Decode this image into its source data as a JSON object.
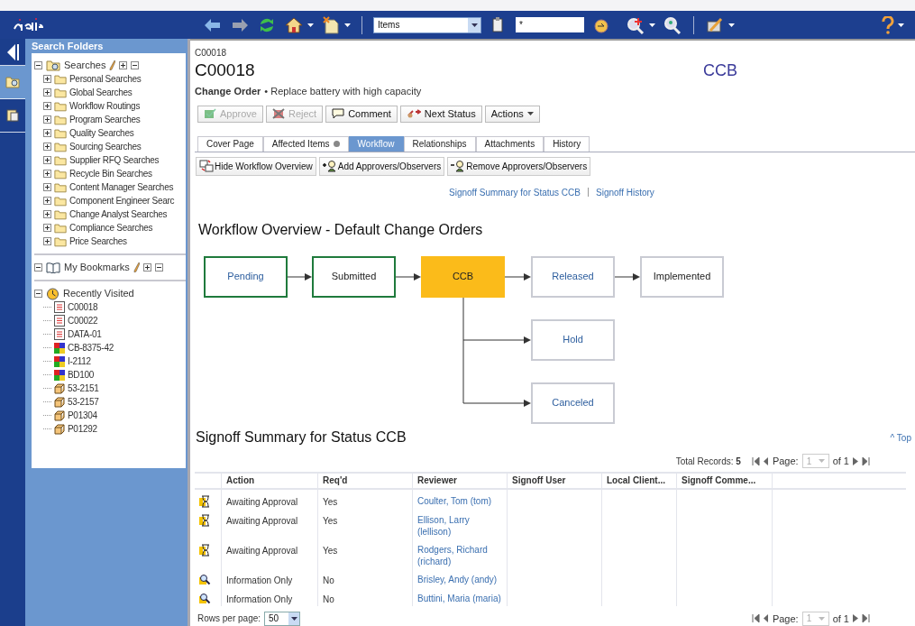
{
  "toolbar": {
    "search_type": "Items",
    "search_text": "*"
  },
  "rail": [
    {
      "kind": "folder",
      "selected": true
    },
    {
      "kind": "doc",
      "selected": false
    }
  ],
  "sidebar": {
    "title": "Search Folders",
    "sections": [
      {
        "label": "Searches",
        "kind": "searches",
        "expanded": true,
        "editable": true,
        "children": [
          {
            "label": "Personal Searches",
            "expanded": false
          },
          {
            "label": "Global Searches",
            "expanded": false
          },
          {
            "label": "Workflow Routings",
            "expanded": false
          },
          {
            "label": "Program Searches",
            "expanded": false
          },
          {
            "label": "Quality Searches",
            "expanded": false
          },
          {
            "label": "Sourcing Searches",
            "expanded": false
          },
          {
            "label": "Supplier RFQ Searches",
            "expanded": false
          },
          {
            "label": "Recycle Bin Searches",
            "expanded": false
          },
          {
            "label": "Content Manager Searches",
            "expanded": false
          },
          {
            "label": "Component Engineer Searc",
            "expanded": false
          },
          {
            "label": "Change Analyst Searches",
            "expanded": false
          },
          {
            "label": "Compliance Searches",
            "expanded": false
          },
          {
            "label": "Price Searches",
            "expanded": false
          }
        ]
      },
      {
        "label": "My Bookmarks",
        "kind": "bookmarks",
        "expanded": true,
        "editable": true
      },
      {
        "label": "Recently Visited",
        "kind": "recent",
        "expanded": true,
        "editable": false,
        "children": [
          {
            "label": "C00018",
            "kind": "doc"
          },
          {
            "label": "C00022",
            "kind": "doc"
          },
          {
            "label": "DATA-01",
            "kind": "doc"
          },
          {
            "label": "CB-8375-42",
            "kind": "part"
          },
          {
            "label": "I-2112",
            "kind": "part"
          },
          {
            "label": "BD100",
            "kind": "part"
          },
          {
            "label": "53-2151",
            "kind": "cube"
          },
          {
            "label": "53-2157",
            "kind": "cube"
          },
          {
            "label": "P01304",
            "kind": "cube"
          },
          {
            "label": "P01292",
            "kind": "cube"
          }
        ]
      }
    ]
  },
  "header": {
    "breadcrumb": "C00018",
    "title": "C00018",
    "status": "CCB",
    "type": "Change Order",
    "description": "• Replace battery with high capacity"
  },
  "actions": [
    {
      "label": "Approve",
      "kind": "approve",
      "disabled": true
    },
    {
      "label": "Reject",
      "kind": "reject",
      "disabled": true
    },
    {
      "label": "Comment",
      "kind": "comment",
      "disabled": false
    },
    {
      "label": "Next Status",
      "kind": "next",
      "disabled": false
    },
    {
      "label": "Actions",
      "kind": "menu",
      "disabled": false
    }
  ],
  "tabs": [
    {
      "label": "Cover Page",
      "selected": false,
      "flag": false
    },
    {
      "label": "Affected Items",
      "selected": false,
      "flag": true
    },
    {
      "label": "Workflow",
      "selected": true,
      "flag": false
    },
    {
      "label": "Relationships",
      "selected": false,
      "flag": false
    },
    {
      "label": "Attachments",
      "selected": false,
      "flag": false
    },
    {
      "label": "History",
      "selected": false,
      "flag": false
    }
  ],
  "workflow_buttons": [
    {
      "label": "Hide Workflow Overview",
      "kind": "hide"
    },
    {
      "label": "Add Approvers/Observers",
      "kind": "add"
    },
    {
      "label": "Remove Approvers/Observers",
      "kind": "remove"
    }
  ],
  "links": [
    "Signoff Summary for Status CCB",
    "Signoff History"
  ],
  "workflow": {
    "title": "Workflow Overview - Default Change Orders",
    "main_path": [
      {
        "label": "Pending",
        "kind": "done",
        "link": true
      },
      {
        "label": "Submitted",
        "kind": "done",
        "link": false
      },
      {
        "label": "CCB",
        "kind": "current",
        "link": false
      },
      {
        "label": "Released",
        "kind": "future",
        "link": true
      },
      {
        "label": "Implemented",
        "kind": "future",
        "link": false
      }
    ],
    "branches": [
      {
        "label": "Hold",
        "kind": "future",
        "link": true
      },
      {
        "label": "Canceled",
        "kind": "future",
        "link": true
      }
    ]
  },
  "signoff": {
    "title": "Signoff Summary for Status CCB",
    "top_link": "^ Top",
    "total": "Total Records: **5**",
    "pagers": [
      {
        "label": "Page:",
        "page": "1",
        "of": "of 1"
      },
      {
        "label": "Page:",
        "page": "1",
        "of": "of 1"
      }
    ],
    "columns": [
      "Action",
      "Req'd",
      "Reviewer",
      "Signoff User",
      "Local Client...",
      "Signoff Comme..."
    ],
    "rows": [
      {
        "kind": "awaiting",
        "action": "Awaiting Approval",
        "required": "Yes",
        "reviewer": "Coulter, Tom (tom)"
      },
      {
        "kind": "awaiting",
        "action": "Awaiting Approval",
        "required": "Yes",
        "reviewer": "Ellison, Larry (lellison)"
      },
      {
        "kind": "awaiting",
        "action": "Awaiting Approval",
        "required": "Yes",
        "reviewer": "Rodgers, Richard (richard)"
      },
      {
        "kind": "info",
        "action": "Information Only",
        "required": "No",
        "reviewer": "Brisley, Andy (andy)"
      },
      {
        "kind": "info",
        "action": "Information Only",
        "required": "No",
        "reviewer": "Buttini, Maria (maria)"
      }
    ],
    "rows_per_page": {
      "label": "Rows per page:",
      "value": "50"
    }
  }
}
